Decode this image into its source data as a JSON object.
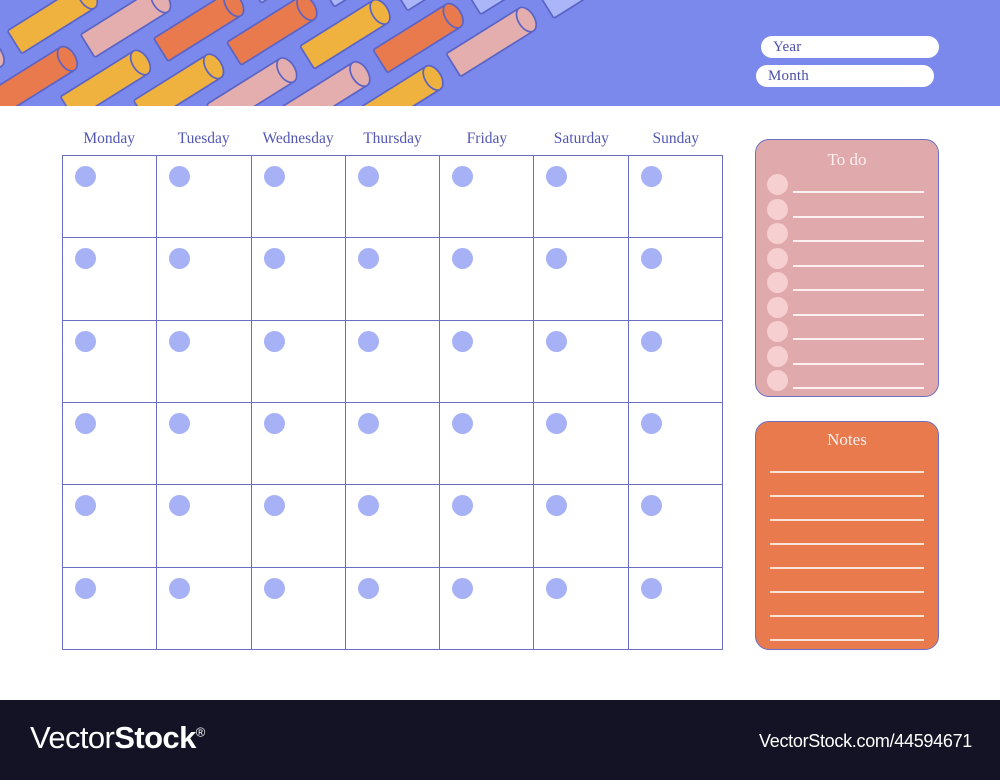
{
  "banner": {
    "name": "decorative-pencil-pattern",
    "background_color": "#7b89ec",
    "stroke_color": "#5b63c4",
    "tube_colors": [
      "#efb23f",
      "#e87a4d",
      "#e5aeae",
      "#aab6f7",
      "#e5b9bb",
      "#f0c44a"
    ]
  },
  "fields": {
    "year": {
      "label": "Year",
      "value": "",
      "placeholder": "Year"
    },
    "month": {
      "label": "Month",
      "value": "",
      "placeholder": "Month"
    }
  },
  "calendar": {
    "day_headers": [
      "Monday",
      "Tuesday",
      "Wednesday",
      "Thursday",
      "Friday",
      "Saturday",
      "Sunday"
    ],
    "rows": 6,
    "columns": 7,
    "cells": [
      [
        "",
        "",
        "",
        "",
        "",
        "",
        ""
      ],
      [
        "",
        "",
        "",
        "",
        "",
        "",
        ""
      ],
      [
        "",
        "",
        "",
        "",
        "",
        "",
        ""
      ],
      [
        "",
        "",
        "",
        "",
        "",
        "",
        ""
      ],
      [
        "",
        "",
        "",
        "",
        "",
        "",
        ""
      ],
      [
        "",
        "",
        "",
        "",
        "",
        "",
        ""
      ]
    ],
    "grid_line_color": "#6a6fc4",
    "dot_color": "#a6b1f6",
    "header_text_color": "#5257b4"
  },
  "todo_panel": {
    "title": "To do",
    "line_count": 9,
    "items": [
      "",
      "",
      "",
      "",
      "",
      "",
      "",
      "",
      ""
    ],
    "background_color": "#e0a9ab",
    "bullet_color": "#f6cfd1",
    "line_color": "#fdf0f1",
    "border_color": "#6a6fc4"
  },
  "notes_panel": {
    "title": "Notes",
    "line_count": 8,
    "items": [
      "",
      "",
      "",
      "",
      "",
      "",
      "",
      ""
    ],
    "background_color": "#e87a4d",
    "line_color": "#fbe3d7",
    "border_color": "#6a6fc4"
  },
  "footer": {
    "logo_part1": "Vector",
    "logo_part2": "Stock",
    "logo_mark": "®",
    "url": "VectorStock.com/44594671",
    "background_color": "#131325"
  }
}
